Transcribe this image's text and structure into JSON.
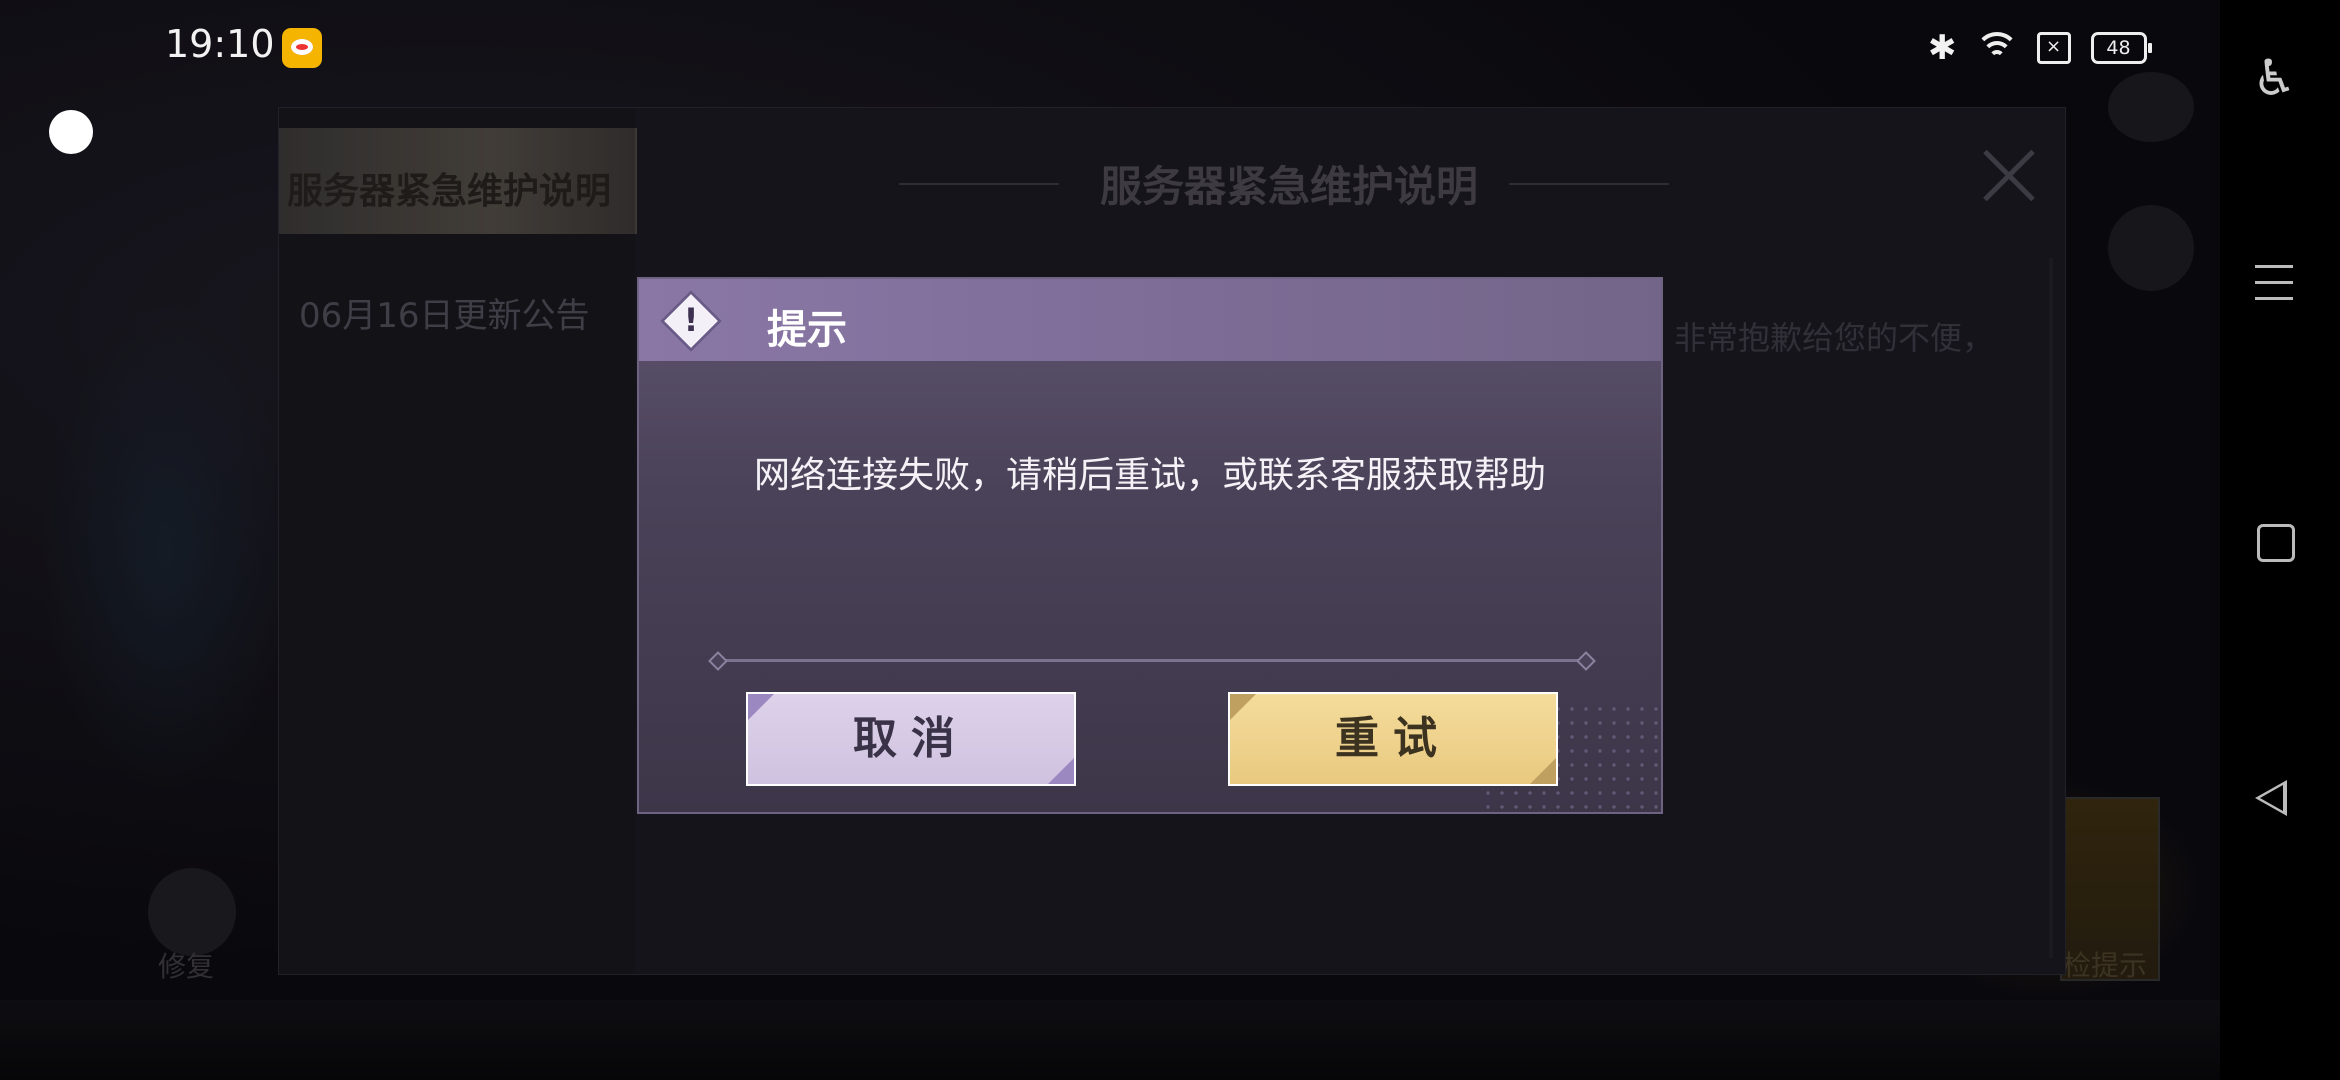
{
  "status_bar": {
    "time": "19:10",
    "battery": "48",
    "icons": [
      "notification-app-icon",
      "bluetooth-icon",
      "wifi-icon",
      "sim-icon",
      "battery-icon"
    ]
  },
  "nav_bar": {
    "icons": [
      "accessibility-icon",
      "menu-icon",
      "home-icon",
      "back-icon"
    ]
  },
  "announcement": {
    "sidebar_tabs": [
      "服务器紧急维护说明",
      "06月16日更新公告"
    ],
    "title": "服务器紧急维护说明",
    "body_excerpt": "非常抱歉给您的不便，"
  },
  "background": {
    "repair_label": "修复",
    "corner_label": "检提示"
  },
  "dialog": {
    "title": "提示",
    "message": "网络连接失败，请稍后重试，或联系客服获取帮助",
    "cancel_label": "取消",
    "retry_label": "重试",
    "colors": {
      "cancel_bg": "#d8cce6",
      "retry_bg": "#efd38d",
      "header": "#8a77a6"
    }
  }
}
